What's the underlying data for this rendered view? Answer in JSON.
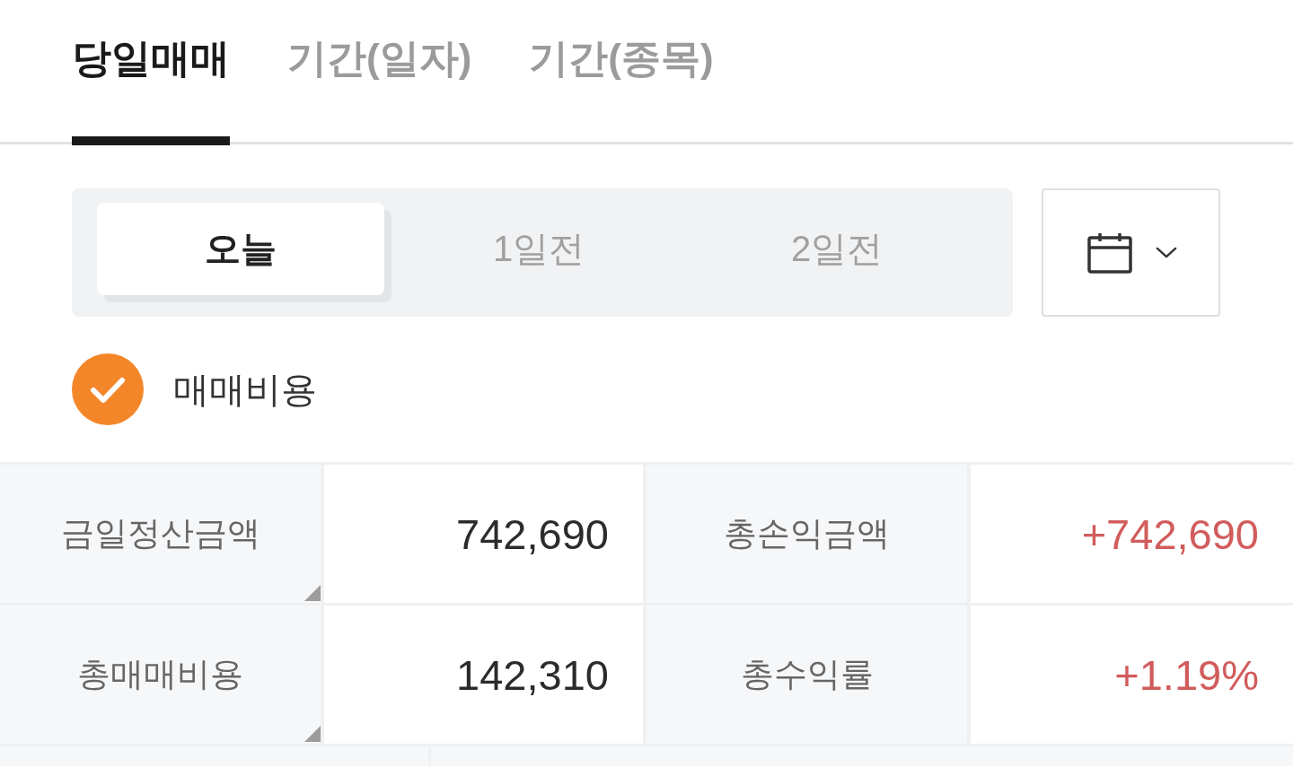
{
  "tabs": [
    {
      "label": "당일매매",
      "selected": true
    },
    {
      "label": "기간(일자)",
      "selected": false
    },
    {
      "label": "기간(종목)",
      "selected": false
    }
  ],
  "day_selector": {
    "options": [
      {
        "label": "오늘",
        "selected": true
      },
      {
        "label": "1일전",
        "selected": false
      },
      {
        "label": "2일전",
        "selected": false
      }
    ]
  },
  "fee_option": {
    "label": "매매비용",
    "checked": true
  },
  "summary": {
    "rows": [
      {
        "cells": [
          {
            "label": "금일정산금액",
            "corner_mark": true,
            "value": "742,690",
            "color": "#2b2b2b"
          },
          {
            "label": "총손익금액",
            "corner_mark": false,
            "value": "+742,690",
            "color": "#d15c5c"
          }
        ]
      },
      {
        "cells": [
          {
            "label": "총매매비용",
            "corner_mark": true,
            "value": "142,310",
            "color": "#2b2b2b"
          },
          {
            "label": "총수익률",
            "corner_mark": false,
            "value": "+1.19%",
            "color": "#d15c5c"
          }
        ]
      }
    ]
  }
}
